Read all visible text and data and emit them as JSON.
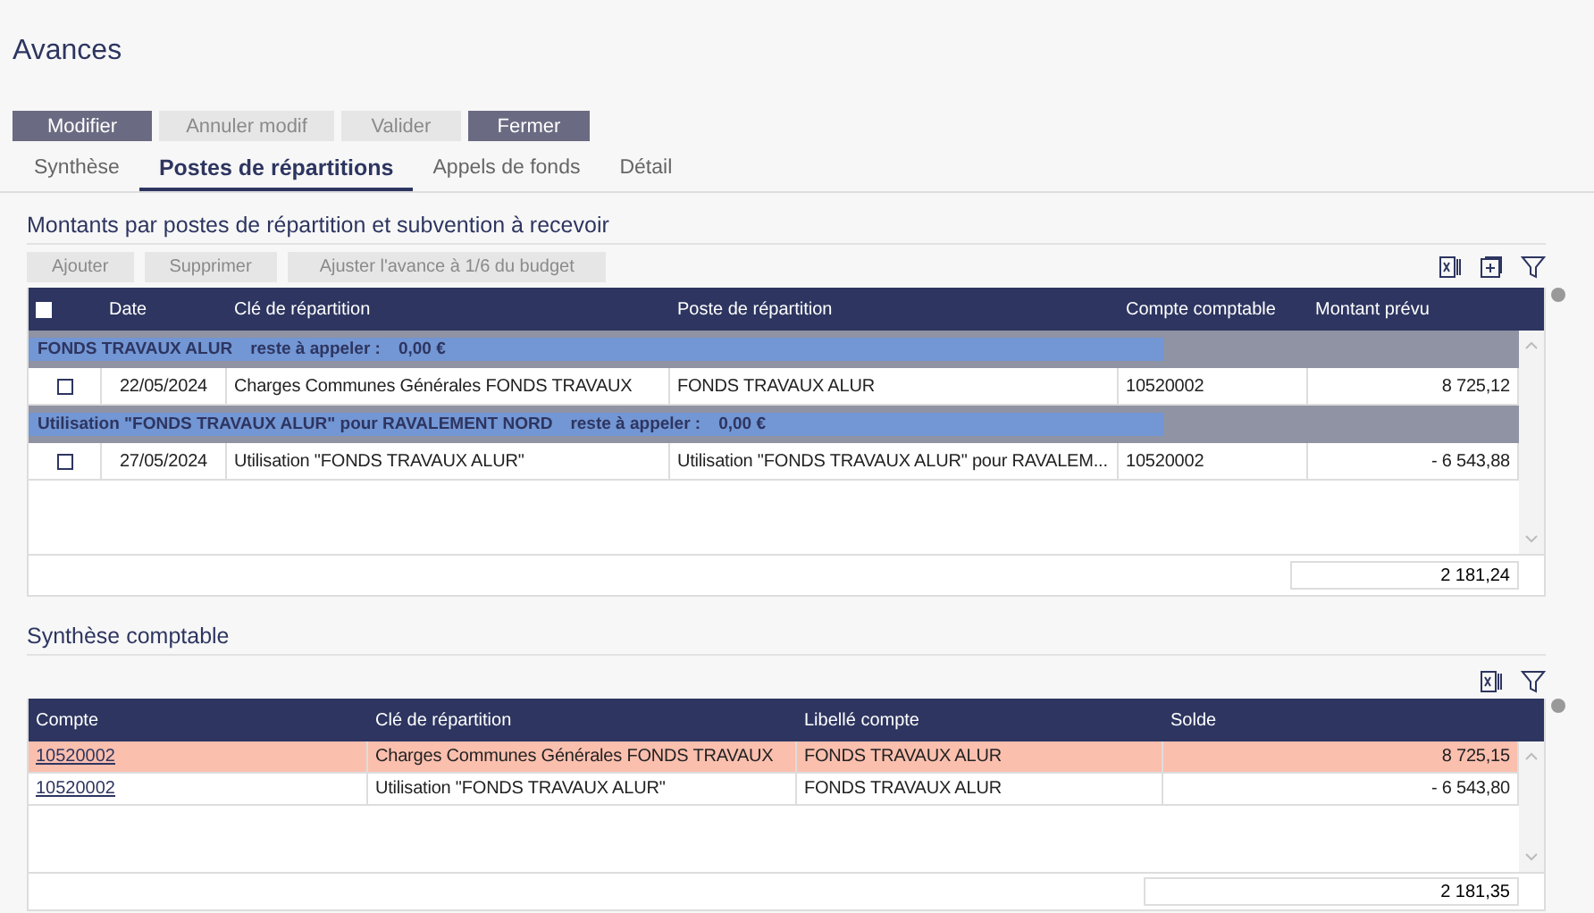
{
  "title": "Avances",
  "actions": [
    {
      "label": "Modifier",
      "disabled": false
    },
    {
      "label": "Annuler modif",
      "disabled": true
    },
    {
      "label": "Valider",
      "disabled": true
    },
    {
      "label": "Fermer",
      "disabled": false
    }
  ],
  "tabs": [
    {
      "label": "Synthèse",
      "selected": false
    },
    {
      "label": "Postes de répartitions",
      "selected": true
    },
    {
      "label": "Appels de fonds",
      "selected": false
    },
    {
      "label": "Détail",
      "selected": false
    }
  ],
  "postes": {
    "title": "Montants par postes de répartition et subvention à recevoir",
    "toolbar": [
      {
        "label": "Ajouter",
        "disabled": true
      },
      {
        "label": "Supprimer",
        "disabled": true
      },
      {
        "label": "Ajuster l'avance à 1/6 du budget",
        "disabled": true
      }
    ],
    "select_all": {
      "checked": false
    },
    "columns": [
      "Date",
      "Clé de répartition",
      "Poste de répartition",
      "Compte comptable",
      "Montant prévu"
    ],
    "groups": [
      {
        "name": "FONDS TRAVAUX ALUR",
        "remaining_label": "reste à appeler :",
        "remaining": "0,00 €",
        "rows": [
          {
            "checked": false,
            "date": "22/05/2024",
            "cle": "Charges Communes Générales FONDS TRAVAUX",
            "poste": "FONDS TRAVAUX ALUR",
            "compte": "10520002",
            "montant": "8 725,12"
          }
        ]
      },
      {
        "name": "Utilisation \"FONDS TRAVAUX ALUR\" pour RAVALEMENT NORD",
        "remaining_label": "reste à appeler :",
        "remaining": "0,00 €",
        "rows": [
          {
            "checked": false,
            "date": "27/05/2024",
            "cle": "Utilisation \"FONDS TRAVAUX ALUR\"",
            "poste": "Utilisation \"FONDS TRAVAUX ALUR\" pour RAVALEM...",
            "compte": "10520002",
            "montant": "- 6 543,88"
          }
        ]
      }
    ],
    "total": "2 181,24"
  },
  "synthese": {
    "title": "Synthèse comptable",
    "columns": [
      "Compte",
      "Clé de répartition",
      "Libellé compte",
      "Solde"
    ],
    "rows": [
      {
        "selected": true,
        "compte": "10520002",
        "cle": "Charges Communes Générales FONDS TRAVAUX",
        "libelle": "FONDS TRAVAUX ALUR",
        "solde": "8 725,15"
      },
      {
        "selected": false,
        "compte": "10520002",
        "cle": "Utilisation \"FONDS TRAVAUX ALUR\"",
        "libelle": "FONDS TRAVAUX ALUR",
        "solde": "- 6 543,80"
      }
    ],
    "total": "2 181,35"
  }
}
